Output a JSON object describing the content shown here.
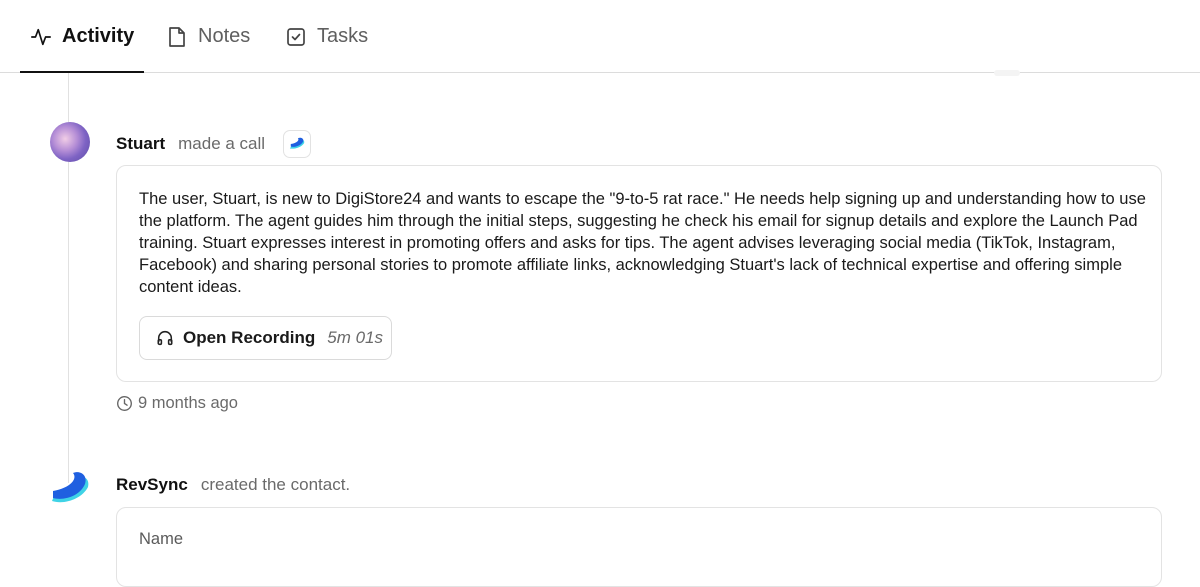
{
  "tabs": [
    {
      "label": "Activity",
      "icon": "activity-icon",
      "active": true
    },
    {
      "label": "Notes",
      "icon": "note-icon",
      "active": false
    },
    {
      "label": "Tasks",
      "icon": "task-checkbox-icon",
      "active": false
    }
  ],
  "events": [
    {
      "actor": "Stuart",
      "action": "made a call",
      "source_icon": "revsync-logo-icon",
      "summary": "The user, Stuart, is new to DigiStore24 and wants to escape the \"9-to-5 rat race.\" He needs help signing up and understanding how to use the platform. The agent guides him through the initial steps, suggesting he check his email for signup details and explore the Launch Pad training. Stuart expresses interest in promoting offers and asks for tips. The agent advises leveraging social media (TikTok, Instagram, Facebook) and sharing personal stories to promote affiliate links, acknowledging Stuart's lack of technical expertise and offering simple content ideas.",
      "recording": {
        "label": "Open Recording",
        "duration": "5m 01s",
        "icon": "headphones-icon"
      },
      "time": "9 months ago"
    },
    {
      "actor": "RevSync",
      "action": "created the contact.",
      "fields": [
        {
          "label": "Name"
        }
      ]
    }
  ],
  "colors": {
    "brand_blue": "#1f5fe0",
    "brand_cyan": "#3fd3e6",
    "text_primary": "#111111",
    "text_muted": "#6a6a6a",
    "border": "#e3e3e3"
  }
}
